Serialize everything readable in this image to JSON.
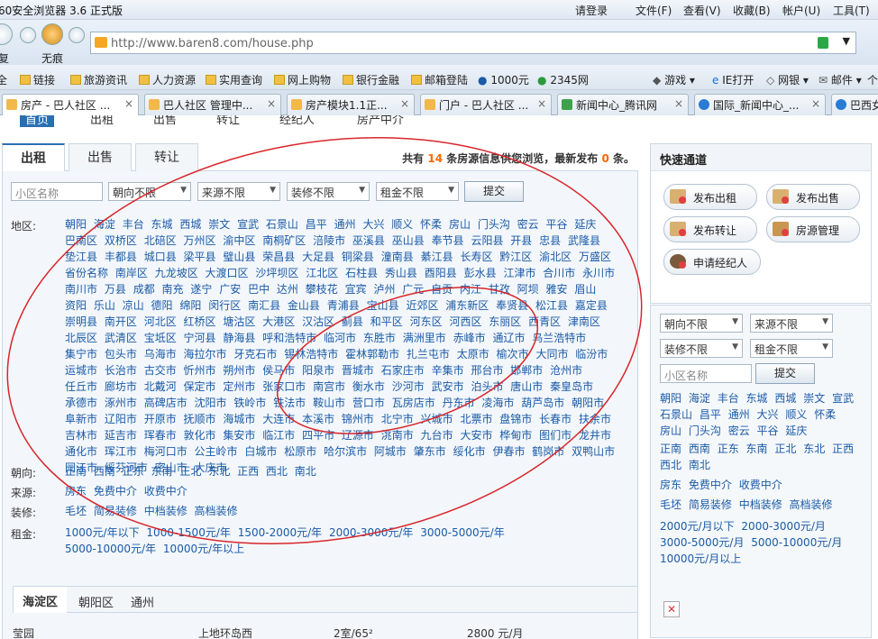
{
  "browser": {
    "title": "60安全浏览器 3.6 正式版",
    "login": "请登录",
    "menus": [
      "文件(F)",
      "查看(V)",
      "收藏(B)",
      "帐户(U)",
      "工具(T)"
    ],
    "back_label": "复",
    "nothing_label": "无痕",
    "url": "http://www.baren8.com/house.php",
    "bookmarks": [
      "全",
      "链接",
      "旅游资讯",
      "人力资源",
      "实用查询",
      "网上购物",
      "银行金融",
      "邮箱登陆",
      "1000元",
      "2345网",
      "游戏",
      "IE打开",
      "网银",
      "邮件",
      "个"
    ],
    "tabs": [
      "房产 - 巴人社区 ...",
      "巴人社区 管理中...",
      "房产模块1.1正...",
      "门户 - 巴人社区 ...",
      "新闻中心_腾讯网",
      "国际_新闻中心_...",
      "巴西女"
    ]
  },
  "page": {
    "topnav": [
      "首页",
      "出租",
      "出售",
      "转让",
      "经纪人",
      "房产中介"
    ],
    "tabs": [
      "出租",
      "出售",
      "转让"
    ],
    "count_prefix": "共有",
    "count_num": "14",
    "count_mid": "条房源信息供您浏览，最新发布",
    "count_new": "0",
    "count_suffix": "条。",
    "search_placeholder": "小区名称",
    "selects": [
      "朝向不限",
      "来源不限",
      "装修不限",
      "租金不限"
    ],
    "submit": "提交",
    "rows": {
      "area_label": "地区:",
      "areas": [
        "朝阳",
        "海淀",
        "丰台",
        "东城",
        "西城",
        "崇文",
        "宣武",
        "石景山",
        "昌平",
        "通州",
        "大兴",
        "顺义",
        "怀柔",
        "房山",
        "门头沟",
        "密云",
        "平谷",
        "延庆",
        "巴南区",
        "双桥区",
        "北碚区",
        "万州区",
        "渝中区",
        "南桐矿区",
        "涪陵市",
        "巫溪县",
        "巫山县",
        "奉节县",
        "云阳县",
        "开县",
        "忠县",
        "武隆县",
        "垫江县",
        "丰都县",
        "城口县",
        "梁平县",
        "璧山县",
        "荣昌县",
        "大足县",
        "铜梁县",
        "潼南县",
        "綦江县",
        "长寿区",
        "黔江区",
        "渝北区",
        "万盛区",
        "省份名称",
        "南岸区",
        "九龙坡区",
        "大渡口区",
        "沙坪坝区",
        "江北区",
        "石柱县",
        "秀山县",
        "酉阳县",
        "彭水县",
        "江津市",
        "合川市",
        "永川市",
        "南川市",
        "万县",
        "成都",
        "南充",
        "遂宁",
        "广安",
        "巴中",
        "达州",
        "攀枝花",
        "宜宾",
        "泸州",
        "广元",
        "自贡",
        "内江",
        "甘孜",
        "阿坝",
        "雅安",
        "眉山",
        "资阳",
        "乐山",
        "凉山",
        "德阳",
        "绵阳",
        "闵行区",
        "南汇县",
        "金山县",
        "青浦县",
        "宝山县",
        "近郊区",
        "浦东新区",
        "奉贤县",
        "松江县",
        "嘉定县",
        "崇明县",
        "南开区",
        "河北区",
        "红桥区",
        "塘沽区",
        "大港区",
        "汉沽区",
        "蓟县",
        "和平区",
        "河东区",
        "河西区",
        "东丽区",
        "西青区",
        "津南区",
        "北辰区",
        "武清区",
        "宝坻区",
        "宁河县",
        "静海县",
        "呼和浩特市",
        "临河市",
        "东胜市",
        "满洲里市",
        "赤峰市",
        "通辽市",
        "乌兰浩特市",
        "集宁市",
        "包头市",
        "乌海市",
        "海拉尔市",
        "牙克石市",
        "锡林浩特市",
        "霍林郭勒市",
        "扎兰屯市",
        "太原市",
        "榆次市",
        "大同市",
        "临汾市",
        "运城市",
        "长治市",
        "古交市",
        "忻州市",
        "朔州市",
        "侯马市",
        "阳泉市",
        "晋城市",
        "石家庄市",
        "辛集市",
        "邢台市",
        "邯郸市",
        "沧州市",
        "任丘市",
        "廊坊市",
        "北戴河",
        "保定市",
        "定州市",
        "张家口市",
        "南宫市",
        "衡水市",
        "沙河市",
        "武安市",
        "泊头市",
        "唐山市",
        "秦皇岛市",
        "承德市",
        "涿州市",
        "高碑店市",
        "沈阳市",
        "铁岭市",
        "铁法市",
        "鞍山市",
        "营口市",
        "瓦房店市",
        "丹东市",
        "凌海市",
        "葫芦岛市",
        "朝阳市",
        "阜新市",
        "辽阳市",
        "开原市",
        "抚顺市",
        "海城市",
        "大连市",
        "本溪市",
        "锦州市",
        "北宁市",
        "兴城市",
        "北票市",
        "盘锦市",
        "长春市",
        "扶余市",
        "吉林市",
        "延吉市",
        "珲春市",
        "敦化市",
        "集安市",
        "临江市",
        "四平市",
        "辽源市",
        "洮南市",
        "九台市",
        "大安市",
        "桦甸市",
        "图们市",
        "龙井市",
        "通化市",
        "珲江市",
        "梅河口市",
        "公主岭市",
        "白城市",
        "松原市",
        "哈尔滨市",
        "阿城市",
        "肇东市",
        "绥化市",
        "伊春市",
        "鹤岗市",
        "双鸭山市",
        "同江市",
        "绥芬河市",
        "密山市",
        "大庆市"
      ],
      "direction_label": "朝向:",
      "directions": [
        "正南",
        "西南",
        "正东",
        "东南",
        "正北",
        "东北",
        "正西",
        "西北",
        "南北"
      ],
      "source_label": "来源:",
      "sources": [
        "房东",
        "免费中介",
        "收费中介"
      ],
      "decor_label": "装修:",
      "decors": [
        "毛坯",
        "简易装修",
        "中档装修",
        "高档装修"
      ],
      "rent_label": "租金:",
      "rents": [
        "1000元/年以下",
        "1000-1500元/年",
        "1500-2000元/年",
        "2000-3000元/年",
        "3000-5000元/年",
        "5000-10000元/年",
        "10000元/年以上"
      ]
    },
    "bottom_tabs": [
      "海淀区",
      "朝阳区",
      "通州"
    ],
    "bottom_row": [
      "莹园",
      "上地环岛西",
      "2室/65²",
      "2800 元/月"
    ]
  },
  "sidebar": {
    "title": "快速通道",
    "buttons": [
      "发布出租",
      "发布出售",
      "发布转让",
      "房源管理",
      "申请经纪人"
    ],
    "selects": [
      "朝向不限",
      "来源不限",
      "装修不限",
      "租金不限"
    ],
    "search_placeholder": "小区名称",
    "submit": "提交",
    "areas": [
      "朝阳",
      "海淀",
      "丰台",
      "东城",
      "西城",
      "崇文",
      "宣武",
      "石景山",
      "昌平",
      "通州",
      "大兴",
      "顺义",
      "怀柔",
      "房山",
      "门头沟",
      "密云",
      "平谷",
      "延庆"
    ],
    "directions": [
      "正南",
      "西南",
      "正东",
      "东南",
      "正北",
      "东北",
      "正西",
      "西北",
      "南北"
    ],
    "sources": [
      "房东",
      "免费中介",
      "收费中介"
    ],
    "decors": [
      "毛坯",
      "简易装修",
      "中档装修",
      "高档装修"
    ],
    "rents": [
      "2000元/月以下",
      "2000-3000元/月",
      "3000-5000元/月",
      "5000-10000元/月",
      "10000元/月以上"
    ]
  },
  "colors": {
    "annotation": "#d8262b",
    "link": "#1a5aa6",
    "accent": "#f60"
  }
}
